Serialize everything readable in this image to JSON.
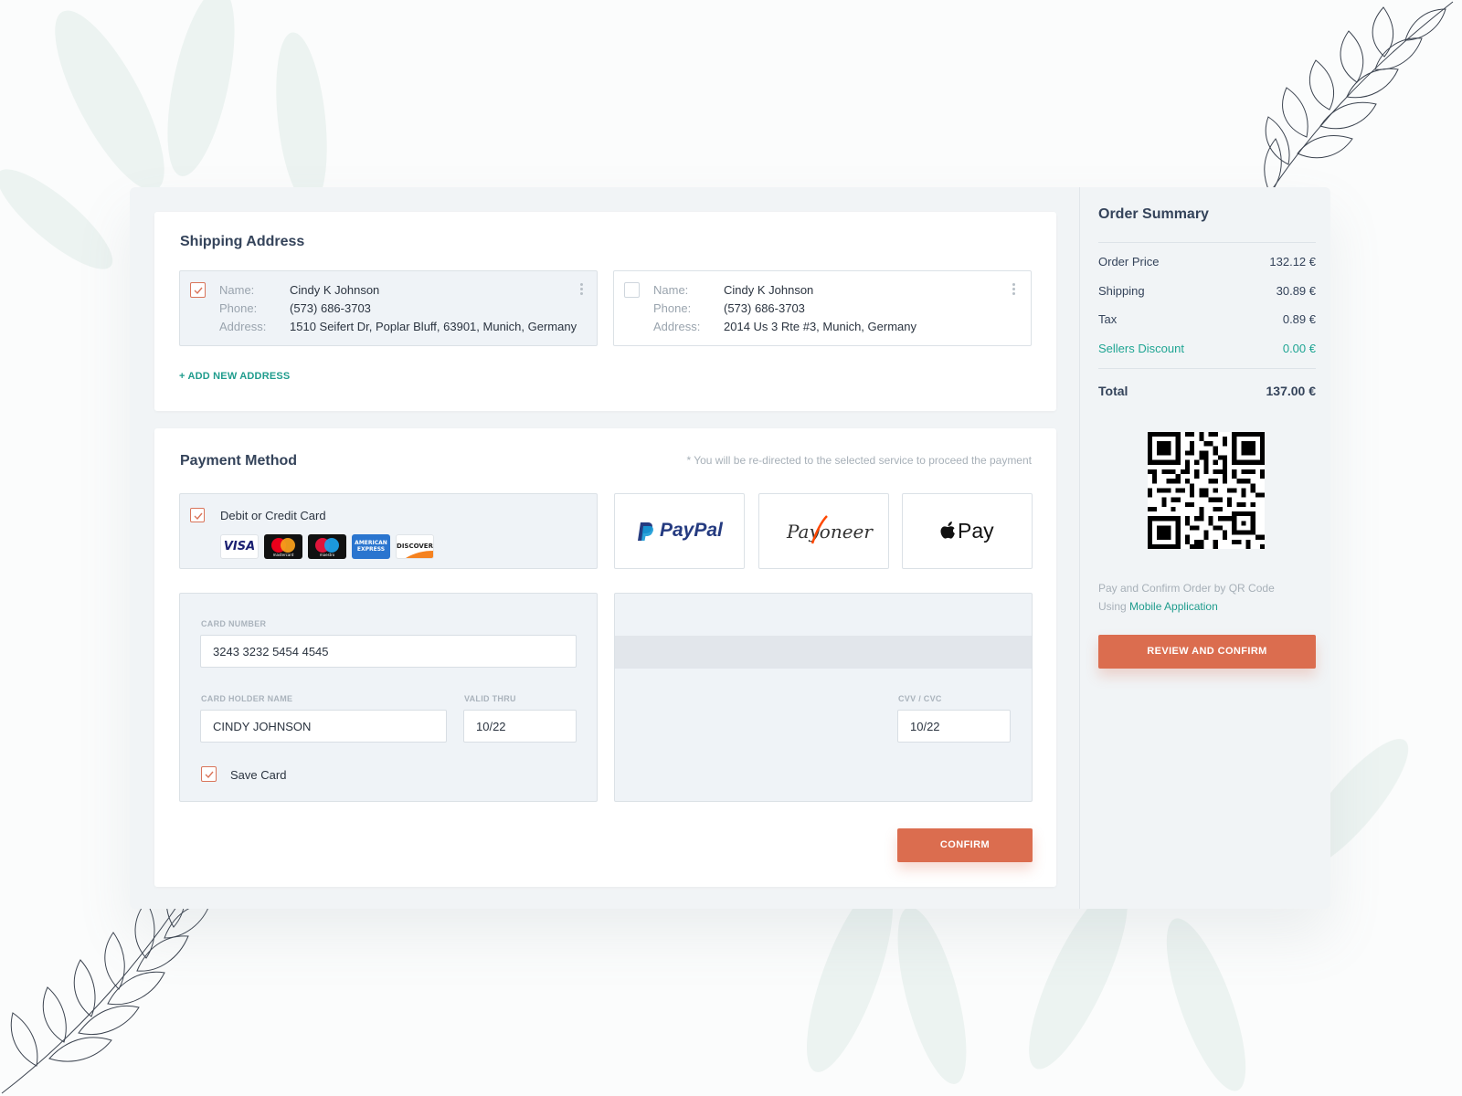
{
  "shipping": {
    "title": "Shipping Address",
    "addresses": [
      {
        "selected": true,
        "name_label": "Name:",
        "name": "Cindy K Johnson",
        "phone_label": "Phone:",
        "phone": "(573) 686-3703",
        "address_label": "Address:",
        "address": "1510 Seifert Dr, Poplar Bluff, 63901, Munich, Germany"
      },
      {
        "selected": false,
        "name_label": "Name:",
        "name": "Cindy K Johnson",
        "phone_label": "Phone:",
        "phone": "(573) 686-3703",
        "address_label": "Address:",
        "address": "2014 Us 3 Rte #3, Munich, Germany"
      }
    ],
    "add_new": "+ ADD NEW ADDRESS"
  },
  "payment": {
    "title": "Payment Method",
    "note": "* You will be re-directed to the selected service to proceed the payment",
    "card_option_label": "Debit or Credit Card",
    "card_logos": {
      "visa": "VISA",
      "mastercard": "mastercard",
      "maestro": "maestro",
      "amex_line1": "AMERICAN",
      "amex_line2": "EXPRESS",
      "discover": "DISCOVER"
    },
    "paypal_label": "PayPal",
    "payoneer_label": "Payoneer",
    "applepay_label": "Pay",
    "card_number_label": "CARD NUMBER",
    "card_number": "3243  3232  5454  4545",
    "holder_label": "CARD HOLDER NAME",
    "holder": "CINDY JOHNSON",
    "valid_label": "VALID THRU",
    "valid": "10/22",
    "cvv_label": "CVV / CVC",
    "cvv": "10/22",
    "save_card_label": "Save Card",
    "save_card_checked": true,
    "confirm_button": "CONFIRM"
  },
  "summary": {
    "title": "Order Summary",
    "rows": [
      {
        "label": "Order Price",
        "value": "132.12 €"
      },
      {
        "label": "Shipping",
        "value": "30.89 €"
      },
      {
        "label": "Tax",
        "value": "0.89 €"
      },
      {
        "label": "Sellers Discount",
        "value": "0.00 €"
      }
    ],
    "total_label": "Total",
    "total_value": "137.00 €",
    "qr_text_1": "Pay and Confirm Order by QR Code",
    "qr_text_2_prefix": "Using",
    "qr_link": "Mobile Application",
    "review_button": "REVIEW AND CONFIRM"
  },
  "colors": {
    "accent": "#db6d4f",
    "teal": "#1f9c8d",
    "panel": "#f1f4f6"
  }
}
